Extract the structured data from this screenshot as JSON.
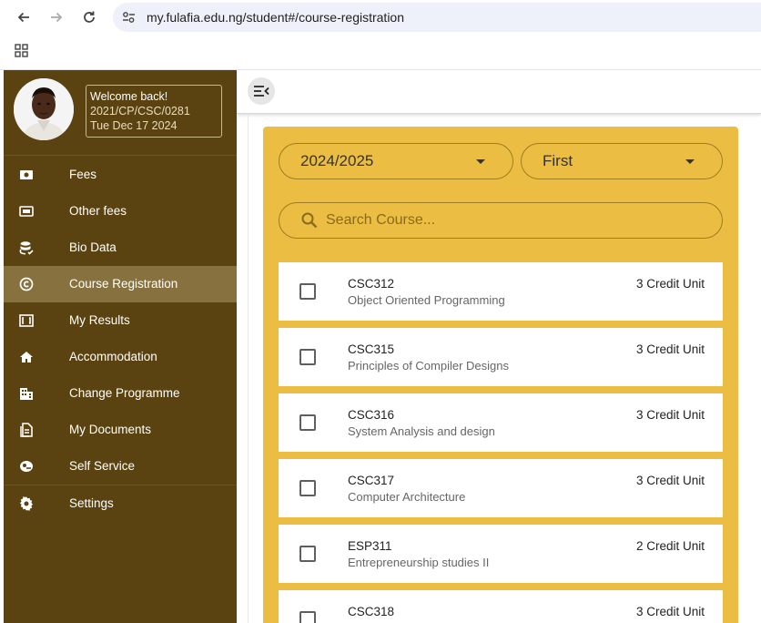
{
  "browser": {
    "url": "my.fulafia.edu.ng/student#/course-registration"
  },
  "profile": {
    "welcome": "Welcome back!",
    "reg_no": "2021/CP/CSC/0281",
    "date": "Tue Dec 17 2024"
  },
  "menu": [
    {
      "label": "Fees",
      "icon": "cash-icon"
    },
    {
      "label": "Other fees",
      "icon": "money-icon"
    },
    {
      "label": "Bio Data",
      "icon": "database-icon"
    },
    {
      "label": "Course Registration",
      "icon": "copyright-icon"
    },
    {
      "label": "My Results",
      "icon": "results-icon"
    },
    {
      "label": "Accommodation",
      "icon": "home-icon"
    },
    {
      "label": "Change Programme",
      "icon": "building-icon"
    },
    {
      "label": "My Documents",
      "icon": "document-icon"
    },
    {
      "label": "Self Service",
      "icon": "self-service-icon"
    },
    {
      "label": "Settings",
      "icon": "gear-icon"
    }
  ],
  "filters": {
    "session": "2024/2025",
    "semester": "First"
  },
  "search": {
    "placeholder": "Search Course..."
  },
  "courses": [
    {
      "code": "CSC312",
      "title": "Object Oriented Programming",
      "units": "3 Credit Unit"
    },
    {
      "code": "CSC315",
      "title": "Principles of Compiler Designs",
      "units": "3 Credit Unit"
    },
    {
      "code": "CSC316",
      "title": "System Analysis and design",
      "units": "3 Credit Unit"
    },
    {
      "code": "CSC317",
      "title": "Computer Architecture",
      "units": "3 Credit Unit"
    },
    {
      "code": "ESP311",
      "title": "Entrepreneurship studies II",
      "units": "2 Credit Unit"
    },
    {
      "code": "CSC318",
      "title": "",
      "units": "3 Credit Unit"
    }
  ],
  "colors": {
    "sidebar": "#5a4311",
    "sidebar_active": "#87723f",
    "panel": "#ebbd42"
  }
}
